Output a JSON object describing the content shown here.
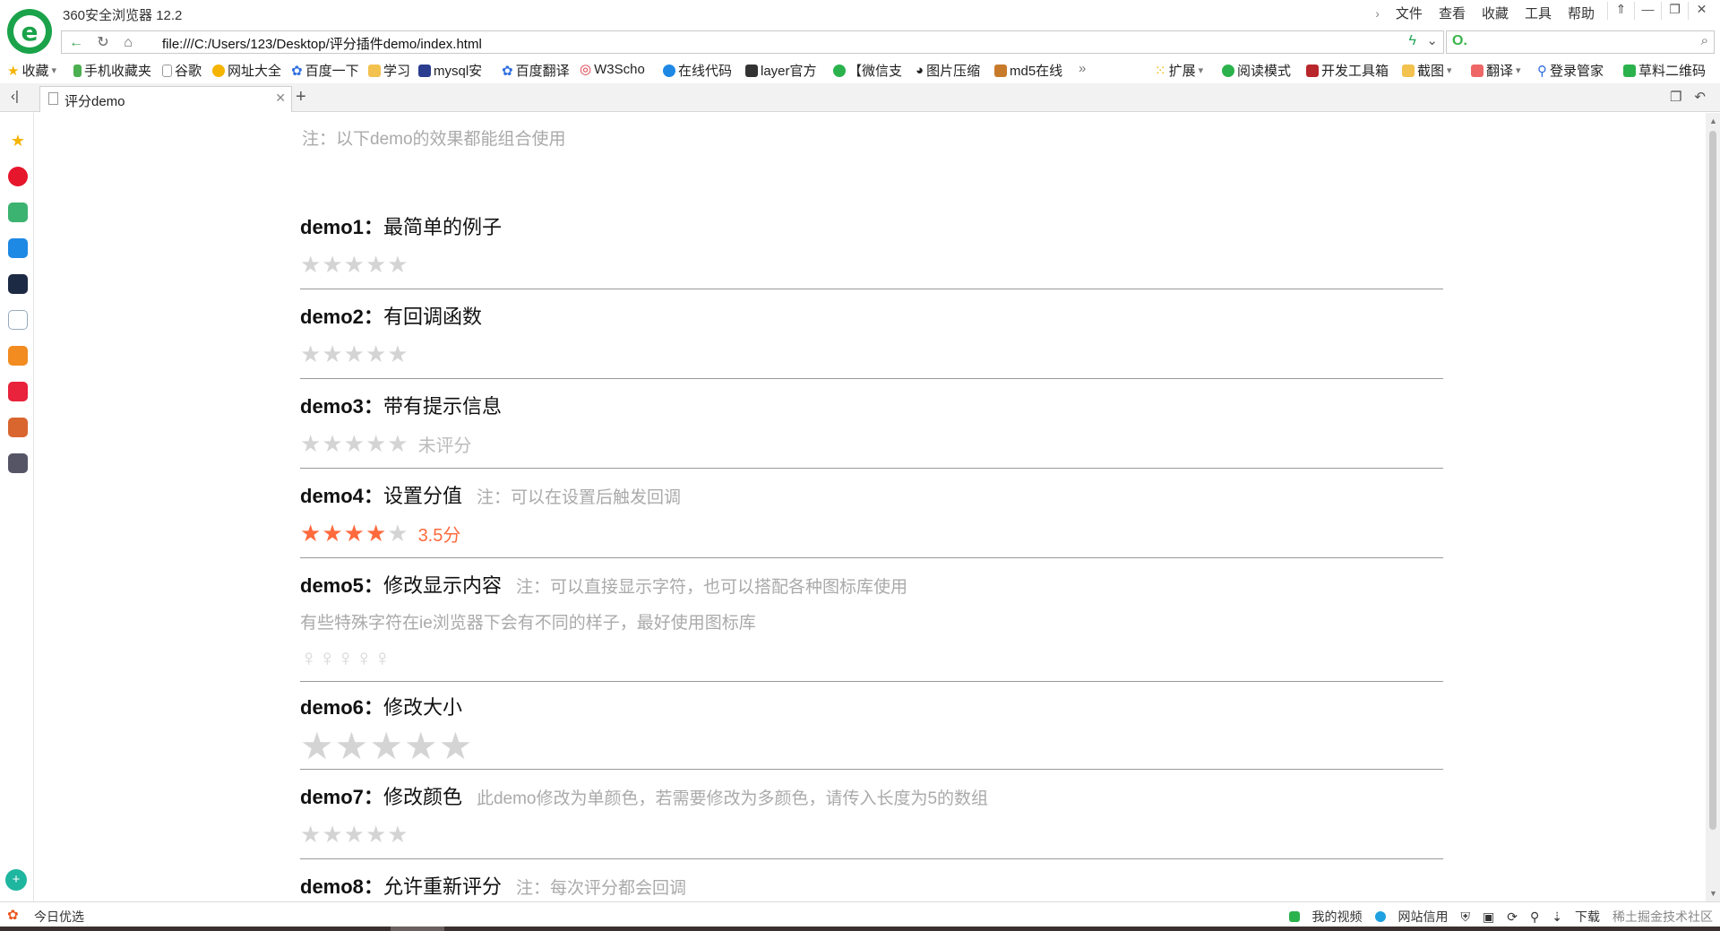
{
  "window": {
    "title": "360安全浏览器 12.2",
    "menu": [
      "文件",
      "查看",
      "收藏",
      "工具",
      "帮助"
    ],
    "controls": [
      "⇑",
      "—",
      "❐",
      "✕"
    ]
  },
  "address": {
    "url": "file:///C:/Users/123/Desktop/评分插件demo/index.html",
    "search_prefix": "O.",
    "search_placeholder": ""
  },
  "bookmarks": {
    "left": [
      "收藏",
      "手机收藏夹",
      "谷歌",
      "网址大全",
      "百度一下",
      "学习",
      "mysql安",
      "百度翻译",
      "W3Scho",
      "在线代码",
      "layer官方",
      "【微信支",
      "图片压缩",
      "md5在线"
    ],
    "more": "»",
    "right": [
      "扩展",
      "阅读模式",
      "开发工具箱",
      "截图",
      "翻译",
      "登录管家",
      "草料二维码"
    ]
  },
  "tabs": [
    {
      "label": "评分demo"
    }
  ],
  "content": {
    "top_note": "注：以下demo的效果都能组合使用",
    "demos": [
      {
        "title": "demo1",
        "desc": "最简单的例子",
        "note": "",
        "subnote": "",
        "stars": 5,
        "filled": 0,
        "message": ""
      },
      {
        "title": "demo2",
        "desc": "有回调函数",
        "note": "",
        "subnote": "",
        "stars": 5,
        "filled": 0,
        "message": ""
      },
      {
        "title": "demo3",
        "desc": "带有提示信息",
        "note": "",
        "subnote": "",
        "stars": 5,
        "filled": 0,
        "message": "未评分"
      },
      {
        "title": "demo4",
        "desc": "设置分值",
        "note": "注：可以在设置后触发回调",
        "subnote": "",
        "stars": 5,
        "filled": 4,
        "message": "3.5分"
      },
      {
        "title": "demo5",
        "desc": "修改显示内容",
        "note": "注：可以直接显示字符，也可以搭配各种图标库使用",
        "subnote": "有些特殊字符在ie浏览器下会有不同的样子，最好使用图标库",
        "stars": 5,
        "filled": 0,
        "message": ""
      },
      {
        "title": "demo6",
        "desc": "修改大小",
        "note": "",
        "subnote": "",
        "stars": 5,
        "filled": 0,
        "message": ""
      },
      {
        "title": "demo7",
        "desc": "修改颜色",
        "note": "此demo修改为单颜色，若需要修改为多颜色，请传入长度为5的数组",
        "subnote": "",
        "stars": 5,
        "filled": 0,
        "message": ""
      },
      {
        "title": "demo8",
        "desc": "允许重新评分",
        "note": "注：每次评分都会回调",
        "subnote": "",
        "stars": 0,
        "filled": 0,
        "message": ""
      }
    ],
    "star_char": "★",
    "female_char": "♀",
    "colon": "："
  },
  "statusbar": {
    "left": "今日优选",
    "right": [
      "我的视频",
      "网站信用",
      "下载",
      "稀土掘金技术社区"
    ]
  },
  "colors": {
    "accent": "#ff6a3d",
    "star_empty": "#d4d4d4",
    "brand_green": "#1aa34a"
  }
}
